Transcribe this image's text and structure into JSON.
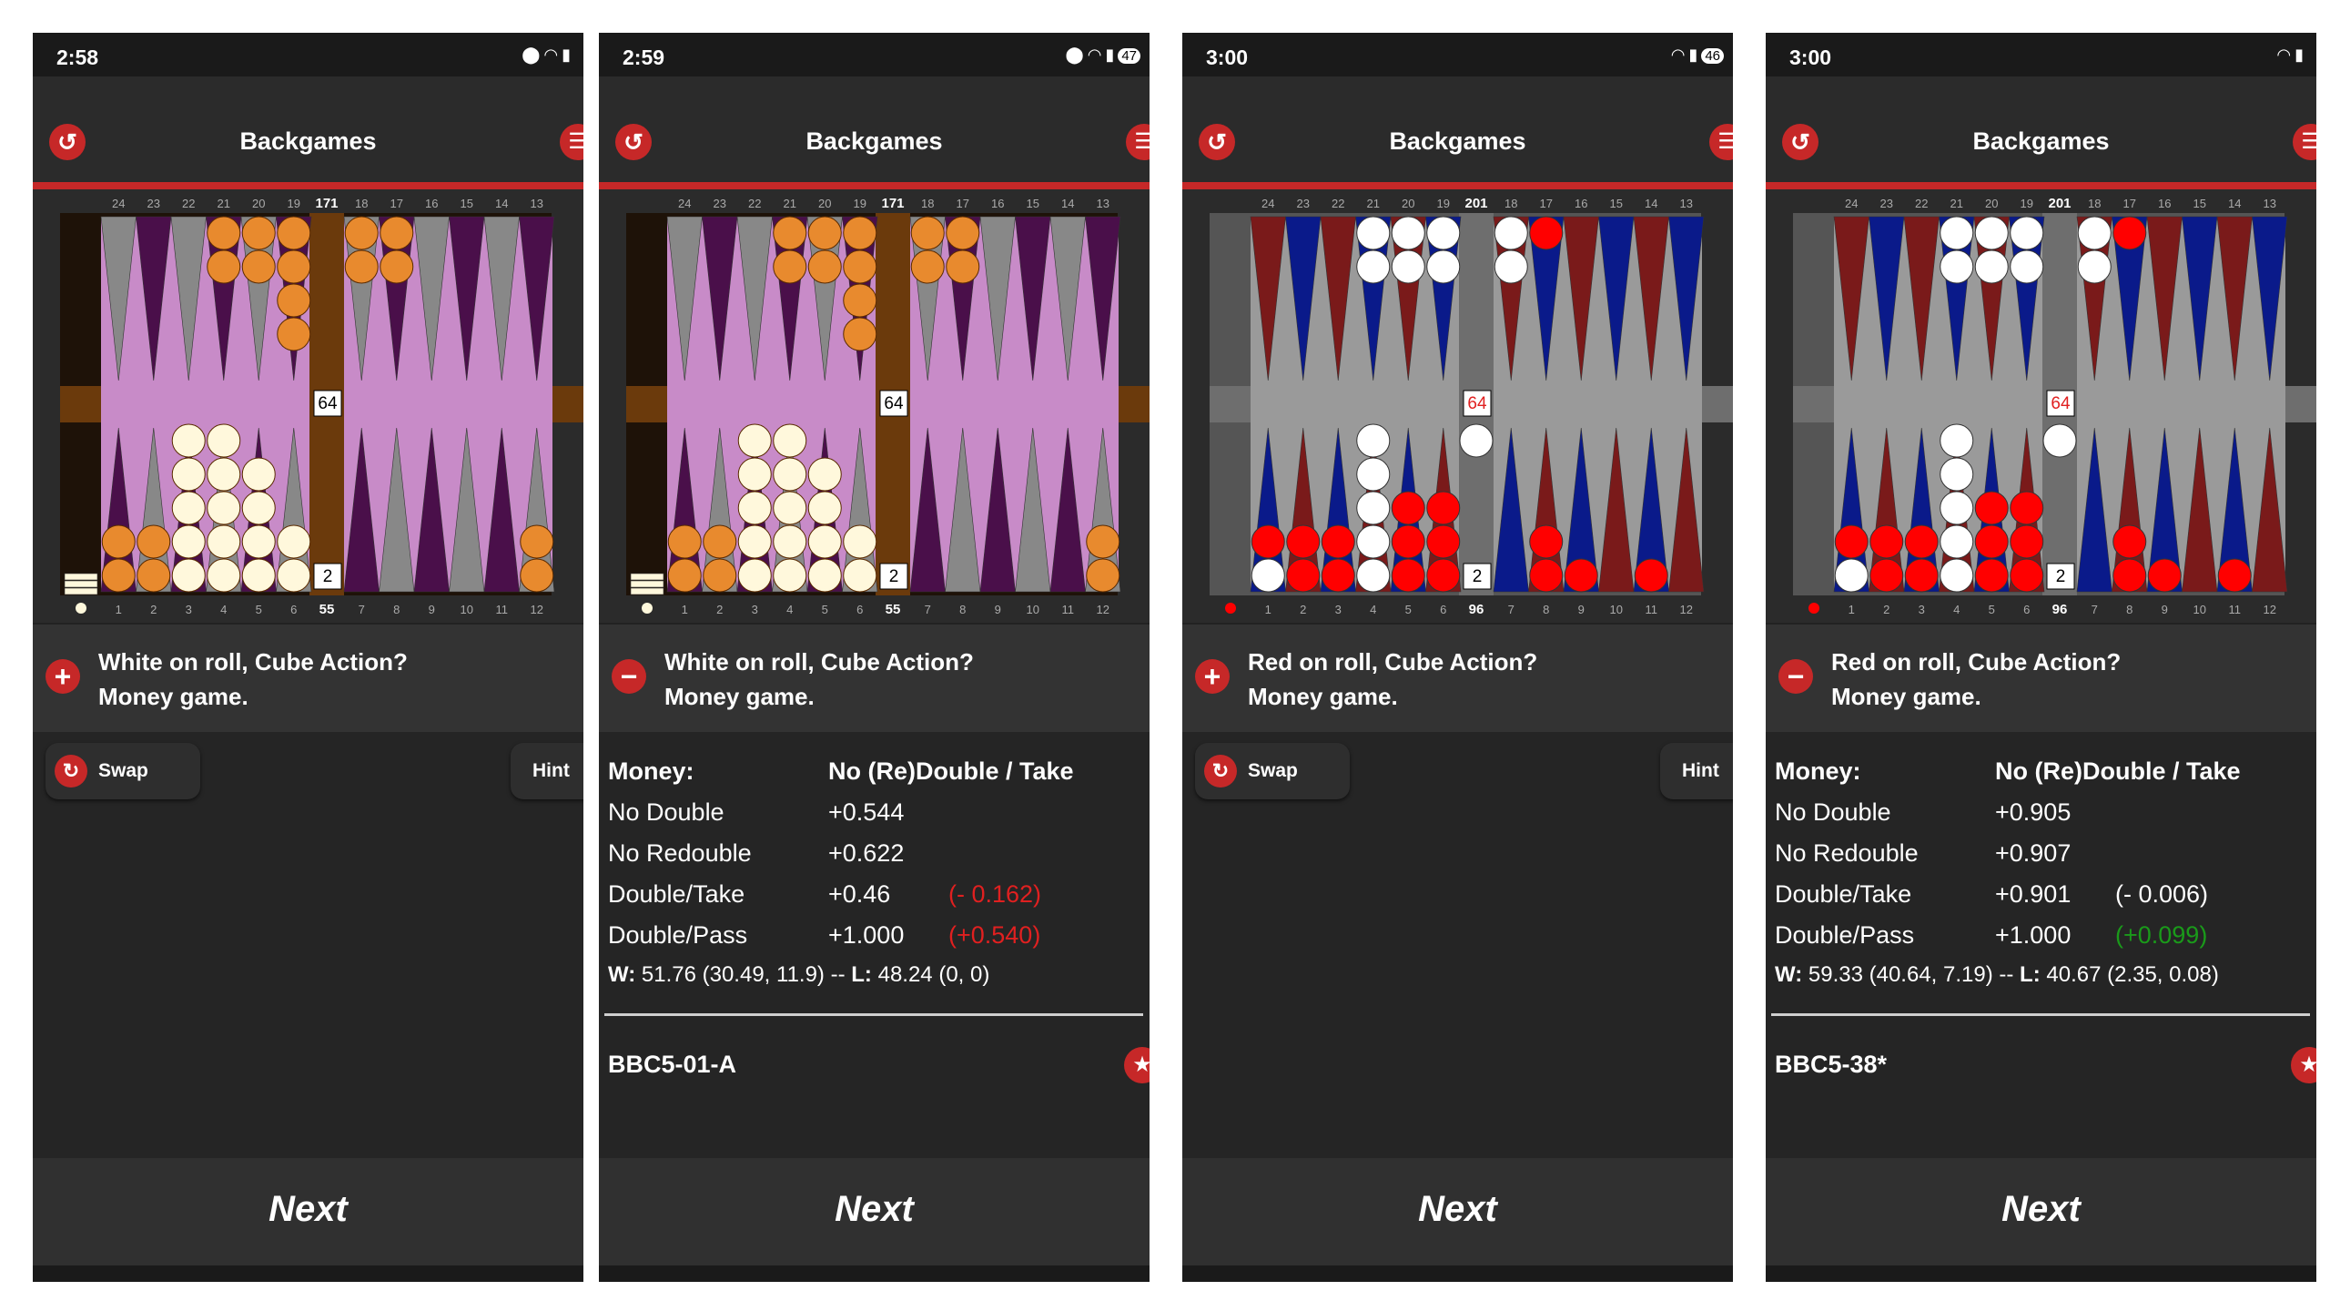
{
  "screens": [
    {
      "time": "2:58",
      "status_icons": [
        "location-icon",
        "wifi-icon",
        "signal-icon"
      ],
      "battery": "",
      "title": "Backgames",
      "theme": {
        "frame": "#1e1208",
        "bar": "#6b3a0c",
        "felt": "#c88bc8",
        "pointA": "#888888",
        "pointB": "#4a0f4a",
        "top": "#e88a2e",
        "bot": "#fff8dc",
        "stroke": "#5a2a00"
      },
      "board": {
        "top_labels": [
          "24",
          "23",
          "22",
          "21",
          "20",
          "19",
          "18",
          "17",
          "16",
          "15",
          "14",
          "13"
        ],
        "bot_labels": [
          "1",
          "2",
          "3",
          "4",
          "5",
          "6",
          "7",
          "8",
          "9",
          "10",
          "11",
          "12"
        ],
        "pip_top": "171",
        "pip_bottom": "55",
        "cube": "64",
        "dice": "2",
        "top": [
          0,
          0,
          0,
          2,
          2,
          4,
          2,
          2,
          0,
          0,
          0,
          0
        ],
        "bottom": [
          2,
          2,
          5,
          5,
          4,
          2,
          0,
          0,
          0,
          0,
          0,
          2
        ],
        "bottom_colors": [
          "top",
          "top",
          "bot",
          "bot",
          "bot",
          "bot",
          "bot",
          "bot",
          "bot",
          "bot",
          "bot",
          "top"
        ],
        "bear_off": true,
        "side_dot": "#fff8dc"
      },
      "question_icon": "plus-icon",
      "question_line1": "White on roll, Cube Action?",
      "question_line2": "Money game.",
      "swap_label": "Swap",
      "hint_label": "Hint",
      "show_analysis": false,
      "next_label": "Next"
    },
    {
      "time": "2:59",
      "status_icons": [
        "location-icon",
        "wifi-icon",
        "signal-icon"
      ],
      "battery": "47",
      "title": "Backgames",
      "theme": {
        "frame": "#1e1208",
        "bar": "#6b3a0c",
        "felt": "#c88bc8",
        "pointA": "#888888",
        "pointB": "#4a0f4a",
        "top": "#e88a2e",
        "bot": "#fff8dc",
        "stroke": "#5a2a00"
      },
      "board": {
        "top_labels": [
          "24",
          "23",
          "22",
          "21",
          "20",
          "19",
          "18",
          "17",
          "16",
          "15",
          "14",
          "13"
        ],
        "bot_labels": [
          "1",
          "2",
          "3",
          "4",
          "5",
          "6",
          "7",
          "8",
          "9",
          "10",
          "11",
          "12"
        ],
        "pip_top": "171",
        "pip_bottom": "55",
        "cube": "64",
        "dice": "2",
        "top": [
          0,
          0,
          0,
          2,
          2,
          4,
          2,
          2,
          0,
          0,
          0,
          0
        ],
        "bottom": [
          2,
          2,
          5,
          5,
          4,
          2,
          0,
          0,
          0,
          0,
          0,
          2
        ],
        "bottom_colors": [
          "top",
          "top",
          "bot",
          "bot",
          "bot",
          "bot",
          "bot",
          "bot",
          "bot",
          "bot",
          "bot",
          "top"
        ],
        "bear_off": true,
        "side_dot": "#fff8dc"
      },
      "question_icon": "minus-icon",
      "question_line1": "White on roll, Cube Action?",
      "question_line2": "Money game.",
      "show_analysis": true,
      "analysis": {
        "header_label": "Money:",
        "header_value": "No (Re)Double / Take",
        "rows": [
          {
            "label": "No Double",
            "value": "+0.544",
            "diff": "",
            "diff_color": ""
          },
          {
            "label": "No Redouble",
            "value": "+0.622",
            "diff": "",
            "diff_color": ""
          },
          {
            "label": "Double/Take",
            "value": "+0.46",
            "diff": "(- 0.162)",
            "diff_color": "#e02020"
          },
          {
            "label": "Double/Pass",
            "value": "+1.000",
            "diff": "(+0.540)",
            "diff_color": "#e02020"
          }
        ],
        "w_label": "W:",
        "w_value": "51.76 (30.49, 11.9)",
        "dash": "--",
        "l_label": "L:",
        "l_value": "48.24 (0, 0)"
      },
      "code": "BBC5-01-A",
      "next_label": "Next"
    },
    {
      "time": "3:00",
      "status_icons": [
        "wifi-icon",
        "signal-icon"
      ],
      "battery": "46",
      "title": "Backgames",
      "theme": {
        "frame": "#555555",
        "bar": "#6e6e6e",
        "felt": "#9a9a9a",
        "pointA": "#7a1a1a",
        "pointB": "#0a1a8a",
        "top": "#ffffff",
        "bot": "#ff0000",
        "stroke": "#333333"
      },
      "board": {
        "top_labels": [
          "24",
          "23",
          "22",
          "21",
          "20",
          "19",
          "18",
          "17",
          "16",
          "15",
          "14",
          "13"
        ],
        "bot_labels": [
          "1",
          "2",
          "3",
          "4",
          "5",
          "6",
          "7",
          "8",
          "9",
          "10",
          "11",
          "12"
        ],
        "pip_top": "201",
        "pip_bottom": "96",
        "cube": "64",
        "dice": "2",
        "top": [
          0,
          0,
          0,
          2,
          2,
          2,
          2,
          1,
          0,
          0,
          0,
          0
        ],
        "top_colors": [
          "top",
          "top",
          "top",
          "top",
          "top",
          "top",
          "top",
          "bot",
          "top",
          "top",
          "top",
          "top"
        ],
        "bottom": [
          2,
          2,
          2,
          5,
          3,
          3,
          0,
          2,
          1,
          0,
          1,
          0
        ],
        "bottom_colors": [
          "top",
          "bot",
          "bot",
          "top",
          "bot",
          "bot",
          "bot",
          "bot",
          "bot",
          "bot",
          "bot",
          "bot"
        ],
        "bottom_special": {
          "0": [
            "top",
            "bot"
          ],
          "3": [
            "top",
            "top",
            "top",
            "top",
            "top"
          ]
        },
        "bar_checker": true,
        "bear_off": false,
        "side_dot": "#ff0000"
      },
      "question_icon": "plus-icon",
      "question_line1": "Red on roll, Cube Action?",
      "question_line2": "Money game.",
      "swap_label": "Swap",
      "hint_label": "Hint",
      "show_analysis": false,
      "next_label": "Next"
    },
    {
      "time": "3:00",
      "status_icons": [
        "wifi-icon",
        "signal-icon"
      ],
      "battery": "",
      "title": "Backgames",
      "theme": {
        "frame": "#555555",
        "bar": "#6e6e6e",
        "felt": "#9a9a9a",
        "pointA": "#7a1a1a",
        "pointB": "#0a1a8a",
        "top": "#ffffff",
        "bot": "#ff0000",
        "stroke": "#333333"
      },
      "board": {
        "top_labels": [
          "24",
          "23",
          "22",
          "21",
          "20",
          "19",
          "18",
          "17",
          "16",
          "15",
          "14",
          "13"
        ],
        "bot_labels": [
          "1",
          "2",
          "3",
          "4",
          "5",
          "6",
          "7",
          "8",
          "9",
          "10",
          "11",
          "12"
        ],
        "pip_top": "201",
        "pip_bottom": "96",
        "cube": "64",
        "dice": "2",
        "top": [
          0,
          0,
          0,
          2,
          2,
          2,
          2,
          1,
          0,
          0,
          0,
          0
        ],
        "top_colors": [
          "top",
          "top",
          "top",
          "top",
          "top",
          "top",
          "top",
          "bot",
          "top",
          "top",
          "top",
          "top"
        ],
        "bottom": [
          2,
          2,
          2,
          5,
          3,
          3,
          0,
          2,
          1,
          0,
          1,
          0
        ],
        "bottom_colors": [
          "top",
          "bot",
          "bot",
          "top",
          "bot",
          "bot",
          "bot",
          "bot",
          "bot",
          "bot",
          "bot",
          "bot"
        ],
        "bottom_special": {
          "0": [
            "top",
            "bot"
          ],
          "3": [
            "top",
            "top",
            "top",
            "top",
            "top"
          ]
        },
        "bar_checker": true,
        "bear_off": false,
        "side_dot": "#ff0000"
      },
      "question_icon": "minus-icon",
      "question_line1": "Red on roll, Cube Action?",
      "question_line2": "Money game.",
      "show_analysis": true,
      "analysis": {
        "header_label": "Money:",
        "header_value": "No (Re)Double / Take",
        "rows": [
          {
            "label": "No Double",
            "value": "+0.905",
            "diff": "",
            "diff_color": ""
          },
          {
            "label": "No Redouble",
            "value": "+0.907",
            "diff": "",
            "diff_color": ""
          },
          {
            "label": "Double/Take",
            "value": "+0.901",
            "diff": "(- 0.006)",
            "diff_color": "#ffffff"
          },
          {
            "label": "Double/Pass",
            "value": "+1.000",
            "diff": "(+0.099)",
            "diff_color": "#1a9a1a"
          }
        ],
        "w_label": "W:",
        "w_value": "59.33 (40.64, 7.19)",
        "dash": "--",
        "l_label": "L:",
        "l_value": "40.67 (2.35, 0.08)"
      },
      "code": "BBC5-38*",
      "next_label": "Next"
    }
  ]
}
